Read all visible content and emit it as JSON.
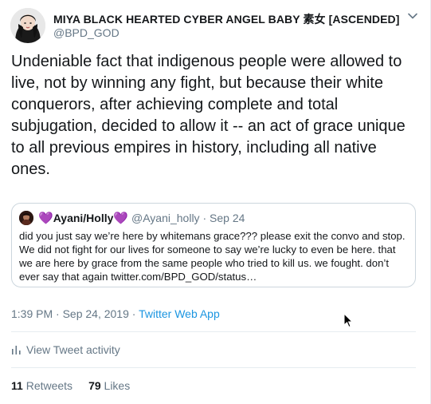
{
  "author": {
    "display_name": "MIYA BLACK HEARTED CYBER ANGEL BABY 素女 [ASCENDED]",
    "handle": "@BPD_GOD"
  },
  "tweet": {
    "text": "Undeniable fact that indigenous people were allowed to live, not by winning any fight, but because their white conquerors, after achieving complete and total subjugation, decided to allow it -- an act of grace unique to all previous empires in history, including all native ones.",
    "timestamp": "1:39 PM · Sep 24, 2019",
    "separator": " · ",
    "source": "Twitter Web App"
  },
  "quoted": {
    "heart_left": "💜",
    "name": "Ayani/Holly",
    "heart_right": "💜",
    "handle": "@Ayani_holly",
    "date": "Sep 24",
    "text": "did you just say we’re here by whitemans grace??? please exit the convo and stop. We did not fight for our lives for someone to say we’re lucky to even be here. that we are here by grace from the same people who tried to kill us. we fought. don’t ever say that again twitter.com/BPD_GOD/status…"
  },
  "activity": {
    "label": "View Tweet activity",
    "icon": "bar-chart-icon"
  },
  "stats": {
    "retweets_count": "11",
    "retweets_label": "Retweets",
    "likes_count": "79",
    "likes_label": "Likes"
  },
  "colors": {
    "link": "#1b95e0",
    "secondary_text": "#657786",
    "heart": "#9b6fd6",
    "border": "#ccd6dd"
  }
}
